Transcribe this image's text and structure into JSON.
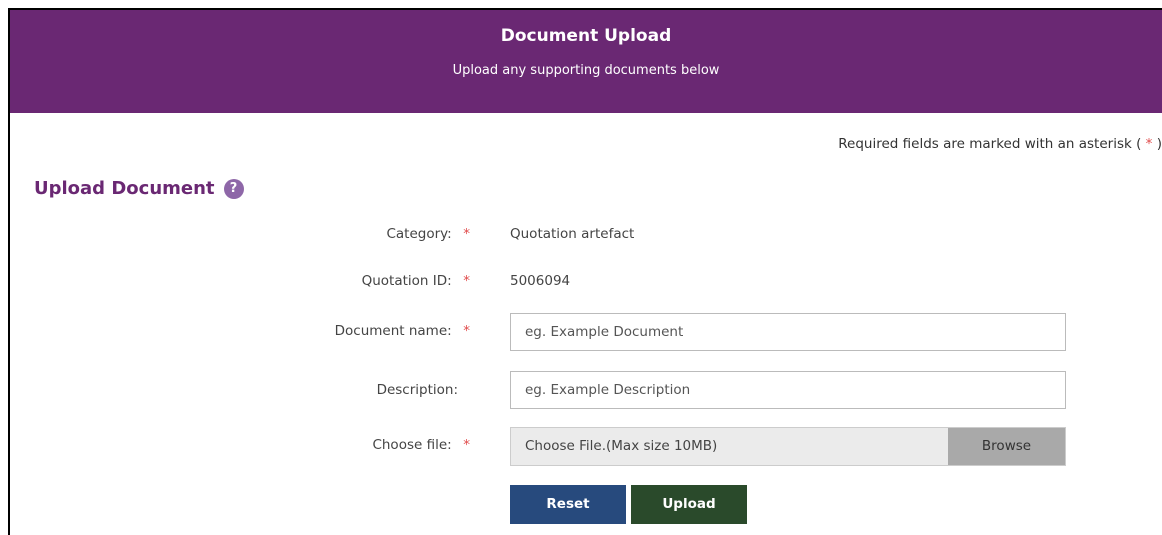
{
  "header": {
    "title": "Document Upload",
    "subtitle": "Upload any supporting documents below"
  },
  "required_note": {
    "text": "Required fields are marked with an asterisk (",
    "star": "*",
    "close": ")"
  },
  "section": {
    "title": "Upload Document",
    "help_icon_glyph": "?"
  },
  "form": {
    "category": {
      "label": "Category:",
      "star": "*",
      "value": "Quotation artefact"
    },
    "quotation_id": {
      "label": "Quotation ID:",
      "star": "*",
      "value": "5006094"
    },
    "document_name": {
      "label": "Document name:",
      "star": "*",
      "placeholder": "eg. Example Document",
      "value": ""
    },
    "description": {
      "label": "Description:",
      "placeholder": "eg. Example Description",
      "value": ""
    },
    "choose_file": {
      "label": "Choose file:",
      "star": "*",
      "placeholder": "Choose File.(Max size 10MB)",
      "browse_label": "Browse"
    }
  },
  "buttons": {
    "reset_label": "Reset",
    "upload_label": "Upload"
  },
  "colors": {
    "banner": "#6a2873",
    "heading": "#6a2873",
    "required_star": "#e04a4a",
    "reset_button": "#274a7d",
    "upload_button": "#2a4a2b",
    "browse_button": "#a9a9a9"
  }
}
